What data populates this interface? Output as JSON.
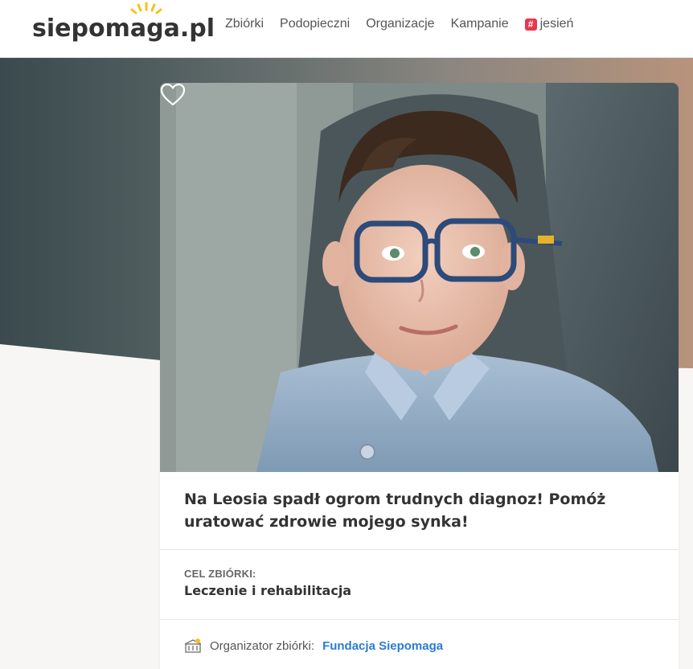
{
  "header": {
    "logo_parts": [
      "sie",
      "po",
      "m",
      "aga.pl"
    ],
    "nav": [
      "Zbiórki",
      "Podopieczni",
      "Organizacje",
      "Kampanie"
    ],
    "campaign_tag": "jesień",
    "campaign_icon": "hash-icon"
  },
  "fundraiser": {
    "title": "Na Leosia spadł ogrom trudnych diagnoz! Pomóż uratować zdrowie mojego synka!",
    "goal_label": "CEL ZBIÓRKI:",
    "goal_value": "Leczenie i rehabilitacja",
    "organizer_label": "Organizator zbiórki:",
    "organizer_name": "Fundacja Siepomaga"
  },
  "colors": {
    "brand_green": "#8dc63f",
    "brand_blue": "#29abe2",
    "brand_red": "#e8364d",
    "link": "#2a7bd4"
  }
}
